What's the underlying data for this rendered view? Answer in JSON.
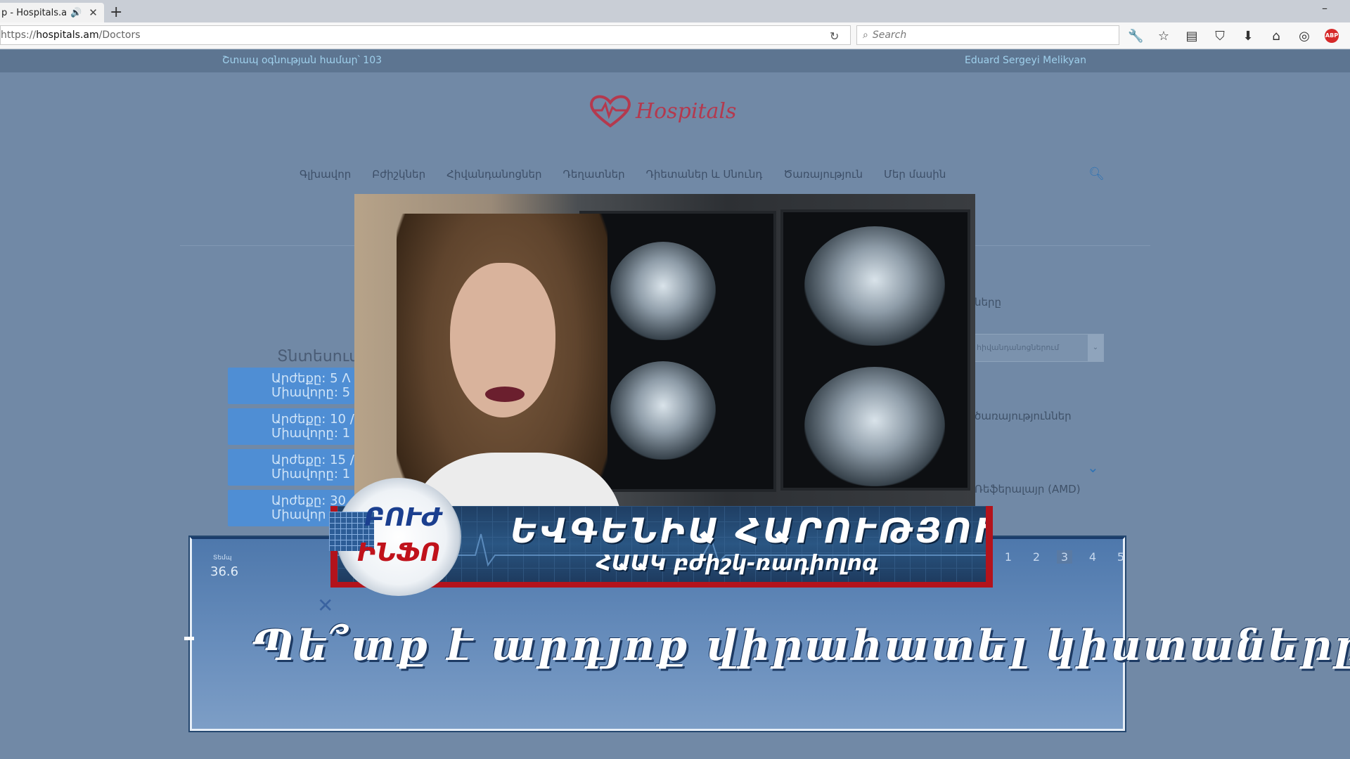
{
  "browser": {
    "tab_title": "p - Hospitals.am",
    "url_prefix": "https://",
    "url_host": "hospitals.am",
    "url_path": "/Doctors",
    "search_placeholder": "Search"
  },
  "site": {
    "topbar_left": "Շտապ օգնության համար՝ 103",
    "topbar_right": "Eduard Sergeyi Melikyan",
    "logo_text": "Hospitals",
    "menu": [
      "Գլխավոր",
      "Բժիշկներ",
      "Հիվանդանոցներ",
      "Դեղատներ",
      "Դիետաներ և Սնունդ",
      "Ծառայություն",
      "Մեր մասին"
    ],
    "section_title": "Տնտեսում",
    "price_cards": [
      {
        "line1": "Արժեքը: 5 Λ",
        "line2": "Միավորը: 5"
      },
      {
        "line1": "Արժեքը: 10 /",
        "line2": "Միավորը: 1"
      },
      {
        "line1": "Արժեքը: 15 /",
        "line2": "Միավորը: 1"
      },
      {
        "line1": "Արժեքը: 30",
        "line2": "Միավոր"
      }
    ],
    "right_labels": [
      "ները",
      "ծառայություններ",
      "Ռեֆերալայր (AMD)"
    ],
    "select_value": "հիվանդանոցներում",
    "temp_label": "Տեմպ",
    "temp_value": "36.6",
    "pages": [
      "1",
      "2",
      "3",
      "4",
      "5"
    ]
  },
  "video": {
    "badge_line1": "ԲՈՒԺ",
    "badge_line2": "ԻՆՖՈ",
    "person_name": "ԵՎԳԵՆԻԱ ՀԱՐՈՒԹՅՈՒՆՅԱՆ",
    "person_title": "ՀԱԱԿ բժիշկ-ռադիոլոգ",
    "quote": "Պե՞տք է արդյոք վիրահատել կիստաները:"
  }
}
